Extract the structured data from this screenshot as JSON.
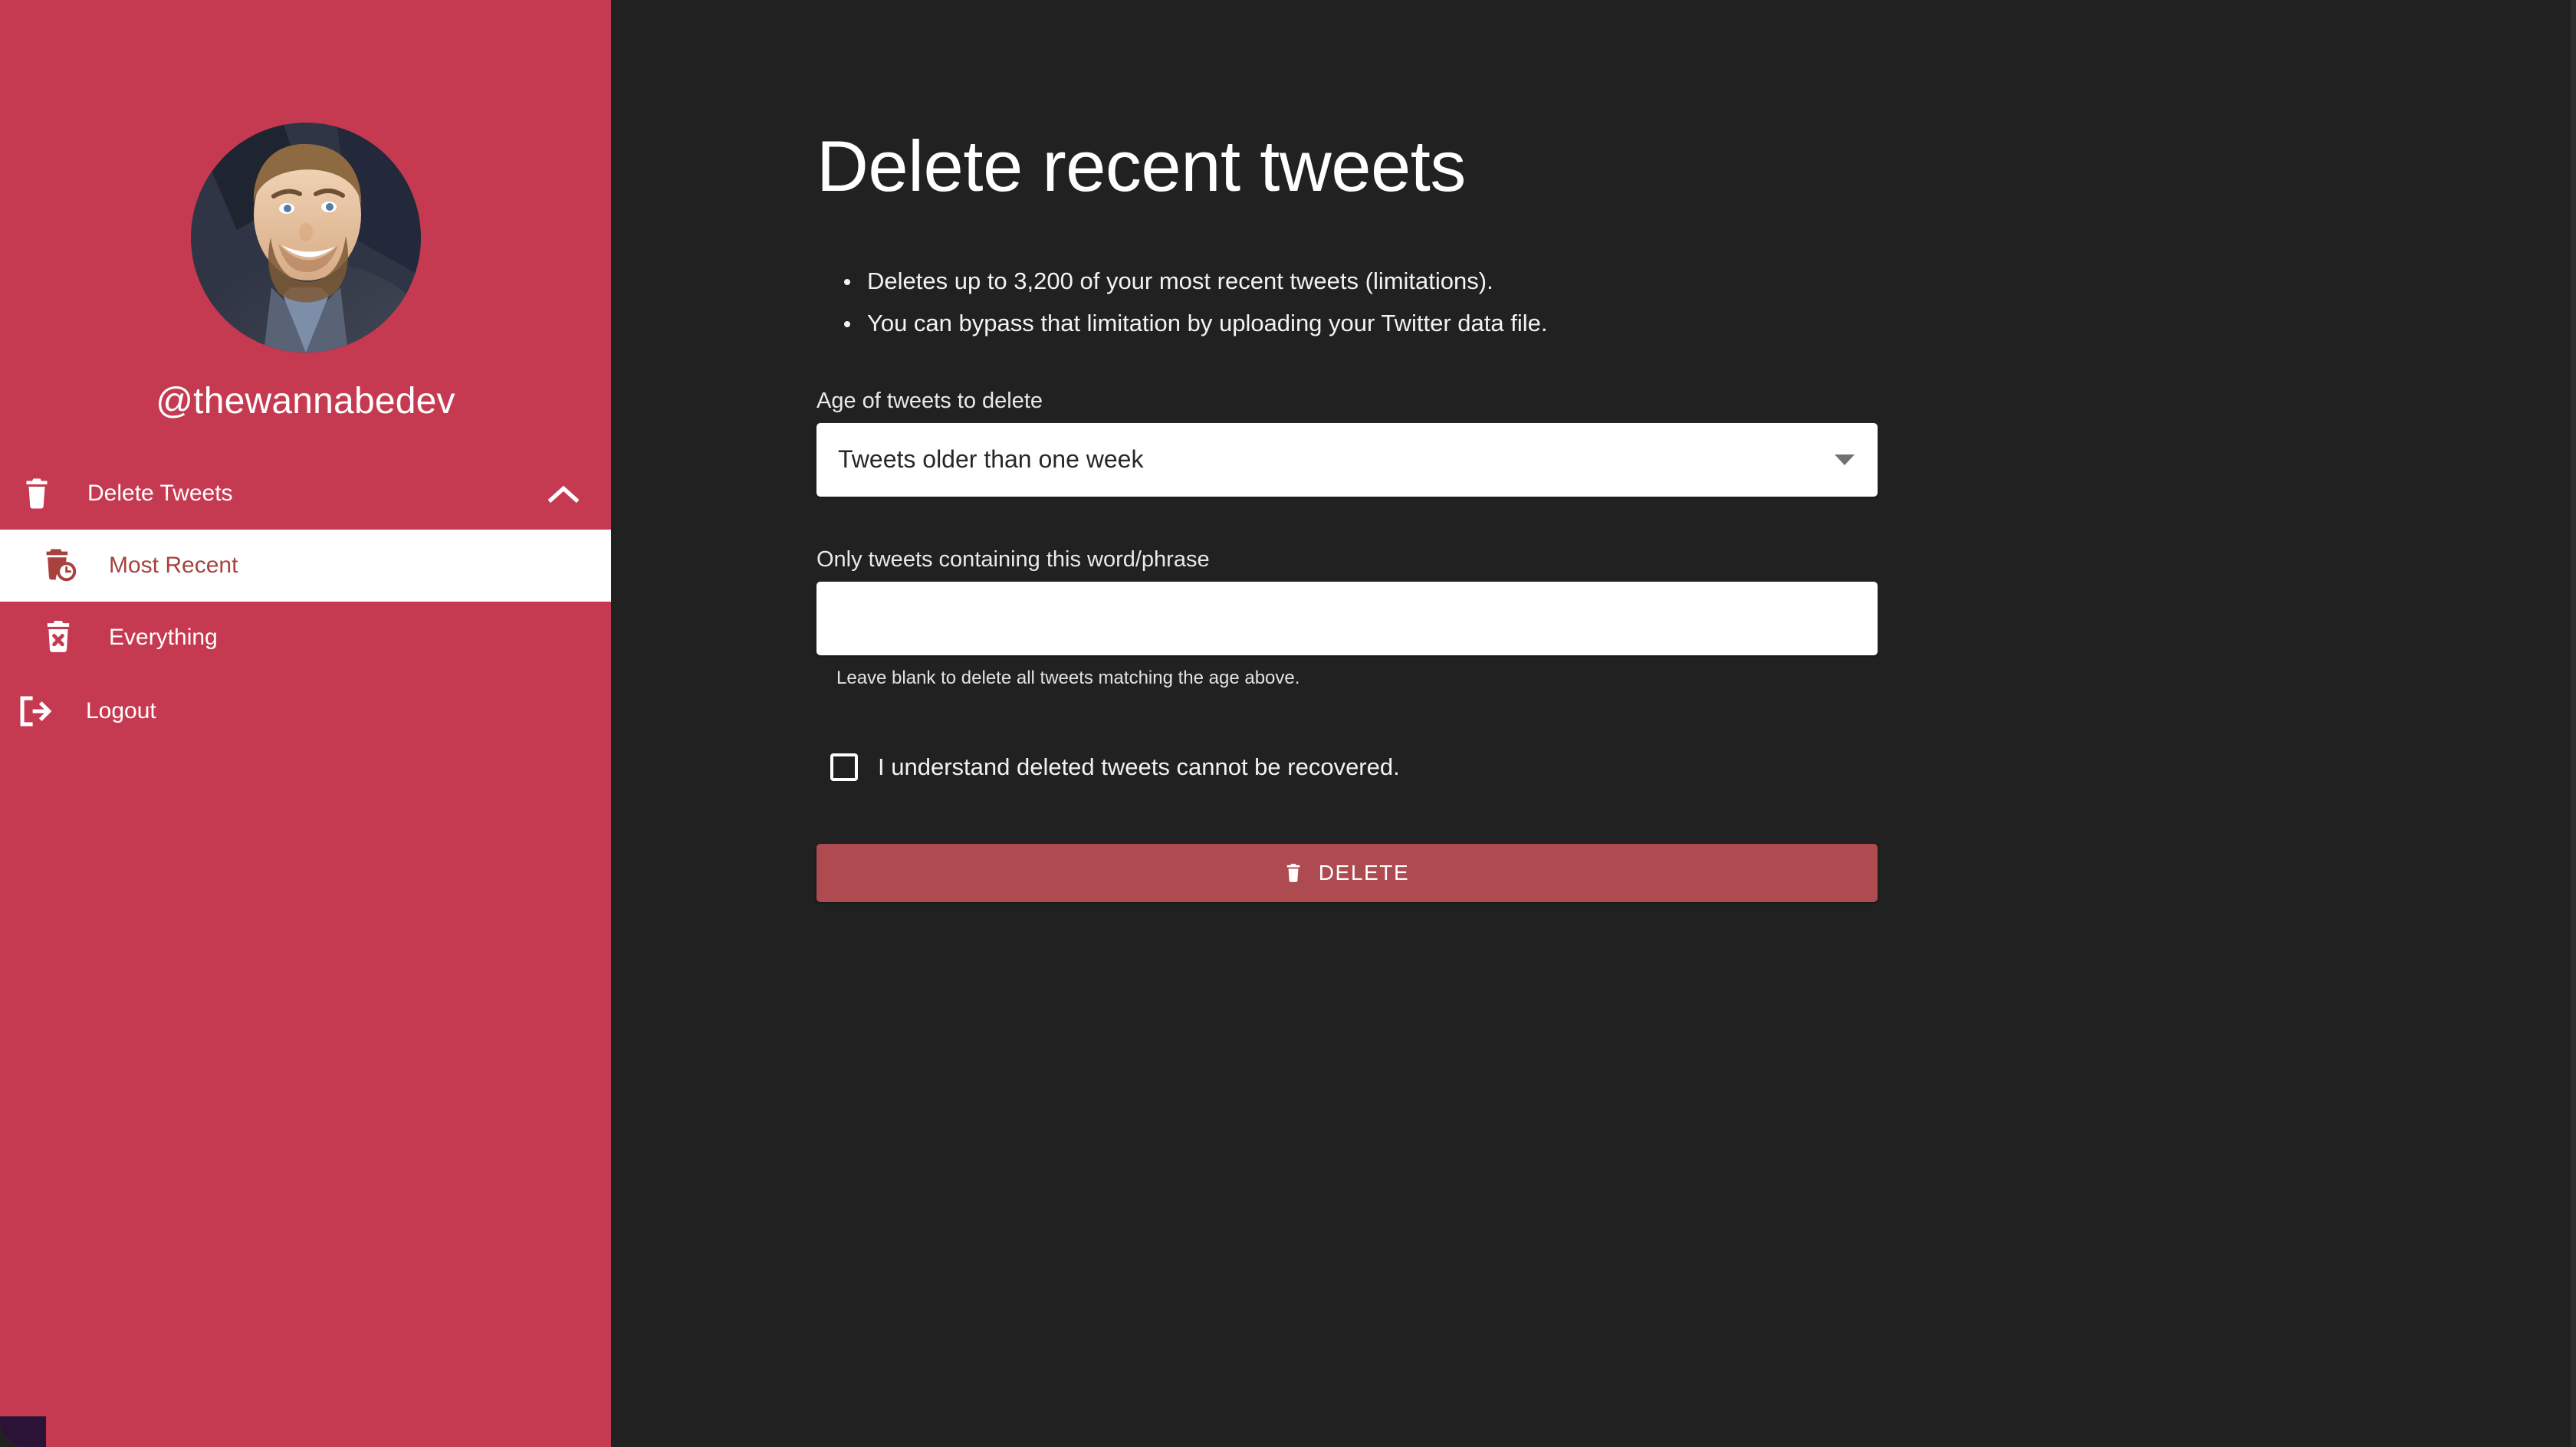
{
  "theme": {
    "sidebar_bg": "#c63a51",
    "main_bg": "#212121",
    "accent": "#c63a51",
    "active_item_bg": "#ffffff",
    "active_item_text": "#a7423f",
    "delete_button_bg": "#ad4b51",
    "field_bg": "#ffffff",
    "text_primary": "#ffffff"
  },
  "sidebar": {
    "avatar_name": "user-avatar",
    "handle": "@thewannabedev",
    "group": {
      "label": "Delete Tweets",
      "icon": "trash-icon",
      "toggle_icon": "chevron-up-icon",
      "expanded": true
    },
    "items": [
      {
        "label": "Most Recent",
        "icon": "trash-clock-icon",
        "active": true
      },
      {
        "label": "Everything",
        "icon": "trash-x-icon",
        "active": false
      }
    ],
    "logout": {
      "label": "Logout",
      "icon": "logout-icon"
    }
  },
  "main": {
    "title": "Delete recent tweets",
    "notes": [
      "Deletes up to 3,200 of your most recent tweets (limitations).",
      "You can bypass that limitation by uploading your Twitter data file."
    ],
    "age_field": {
      "label": "Age of tweets to delete",
      "value": "Tweets older than one week",
      "caret_icon": "chevron-down-icon",
      "options": [
        "Tweets older than one week"
      ]
    },
    "phrase_field": {
      "label": "Only tweets containing this word/phrase",
      "value": "",
      "placeholder": "",
      "helper": "Leave blank to delete all tweets matching the age above."
    },
    "confirm": {
      "label": "I understand deleted tweets cannot be recovered.",
      "checked": false
    },
    "delete_button": {
      "label": "DELETE",
      "icon": "trash-icon"
    }
  }
}
